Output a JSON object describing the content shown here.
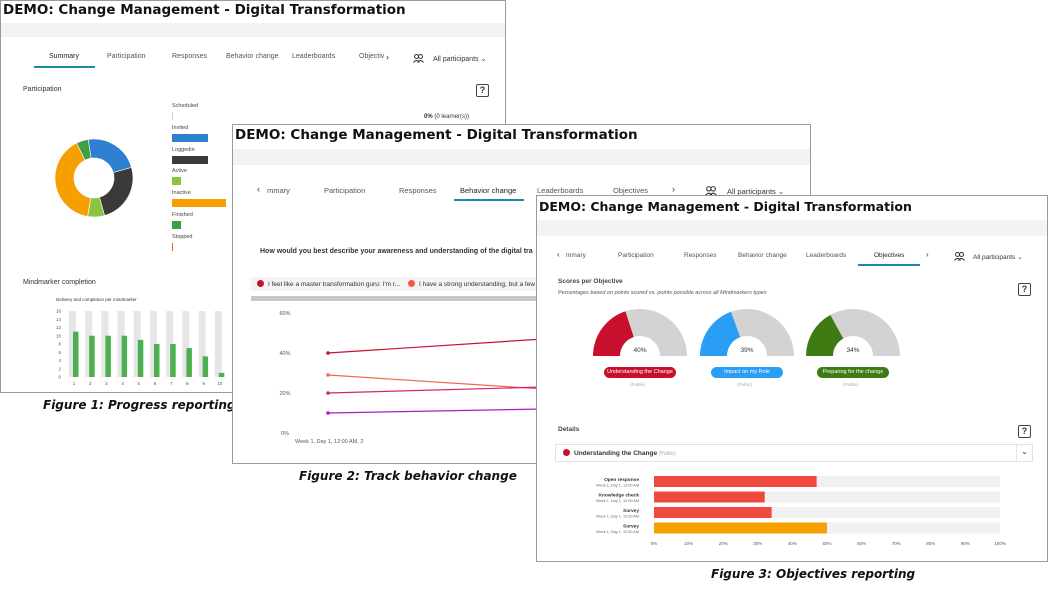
{
  "app_title": "DEMO: Change Management - Digital Transformation",
  "captions": {
    "fig1": "Figure 1: Progress reporting",
    "fig2": "Figure 2: Track behavior change",
    "fig3": "Figure 3: Objectives reporting"
  },
  "fig1": {
    "tabs": [
      "Summary",
      "Participation",
      "Responses",
      "Behavior change",
      "Leaderboards",
      "Objectiv"
    ],
    "active_tab": "Summary",
    "participants_label": "All participants",
    "participation_title": "Participation",
    "status_value": "0%",
    "status_detail": "(0 learner(s))",
    "statuses": [
      {
        "label": "Scheduled",
        "color": "#cccccc",
        "fraction": 0.0
      },
      {
        "label": "Invited",
        "color": "#2f80d1",
        "fraction": 0.6
      },
      {
        "label": "Loggedin",
        "color": "#3a3a3a",
        "fraction": 0.6
      },
      {
        "label": "Active",
        "color": "#8dc43f",
        "fraction": 0.15
      },
      {
        "label": "Inactive",
        "color": "#f5a000",
        "fraction": 0.9
      },
      {
        "label": "Finished",
        "color": "#3f9f47",
        "fraction": 0.15
      },
      {
        "label": "Stopped",
        "color": "#e0602f",
        "fraction": 0.0
      }
    ],
    "donut": [
      {
        "label": "Invited",
        "value": 23,
        "color": "#2f80d1"
      },
      {
        "label": "Loggedin",
        "value": 25,
        "color": "#3a3a3a"
      },
      {
        "label": "Active",
        "value": 7,
        "color": "#8dc43f"
      },
      {
        "label": "Inactive",
        "value": 40,
        "color": "#f5a000"
      },
      {
        "label": "Finished",
        "value": 5,
        "color": "#3f9f47"
      }
    ],
    "mindmarker_title": "Mindmarker completion",
    "chart_data": {
      "type": "bar",
      "title": "Delivery and completion per mindmarker",
      "categories": [
        "1",
        "2",
        "3",
        "4",
        "5",
        "6",
        "7",
        "8",
        "9",
        "10"
      ],
      "ylim": [
        0,
        16
      ],
      "yticks": [
        "0",
        "2",
        "4",
        "6",
        "8",
        "10",
        "12",
        "14",
        "16"
      ],
      "series": [
        {
          "values": [
            16,
            16,
            16,
            16,
            16,
            16,
            16,
            16,
            16,
            16
          ],
          "color": "#e6e6e6"
        },
        {
          "values": [
            11,
            10,
            10,
            10,
            9,
            8,
            8,
            7,
            5,
            1
          ],
          "color": "#4caf50"
        }
      ]
    }
  },
  "fig2": {
    "tabs": [
      "mmary",
      "Participation",
      "Responses",
      "Behavior change",
      "Leaderboards",
      "Objectives"
    ],
    "active_tab": "Behavior change",
    "participants_label": "All participants",
    "question": "How would you best describe your awareness and understanding of the digital tra",
    "legend": [
      {
        "label": "I feel like a master transformation guru: I'm r...",
        "color": "#c8102e"
      },
      {
        "label": "I have a strong understanding, but a few",
        "color": "#ef5b45"
      }
    ],
    "chart_data": {
      "type": "line",
      "yticks": [
        "0%",
        "20%",
        "40%",
        "60%"
      ],
      "ylim": [
        0,
        60
      ],
      "x_label_first": "Week 1, Day 1, 12:00 AM, 2",
      "series": [
        {
          "color": "#c8102e",
          "values": [
            40,
            47
          ]
        },
        {
          "color": "#ef6a4a",
          "values": [
            29,
            22
          ]
        },
        {
          "color": "#d2226e",
          "values": [
            20,
            23
          ]
        },
        {
          "color": "#a020c0",
          "values": [
            10,
            12
          ]
        }
      ]
    }
  },
  "fig3": {
    "tabs": [
      "mmary",
      "Participation",
      "Responses",
      "Behavior change",
      "Leaderboards",
      "Objectives"
    ],
    "active_tab": "Objectives",
    "participants_label": "All participants",
    "scores_title": "Scores per Objective",
    "scores_subtitle": "Percentages based on points scored vs. points possible across all Mindmarkers types",
    "gauges": [
      {
        "value": 40,
        "label": "40%",
        "name": "Understanding the Change",
        "color": "#c8102e",
        "sub": "(Public)"
      },
      {
        "value": 39,
        "label": "39%",
        "name": "Impact on my Role",
        "color": "#2a9df4",
        "sub": "(Public)"
      },
      {
        "value": 34,
        "label": "34%",
        "name": "Preparing for the change",
        "color": "#3e7b13",
        "sub": "(Public)"
      }
    ],
    "details_title": "Details",
    "details_objective": "Understanding the Change",
    "details_objective_sub": "(Public)",
    "details_color": "#c8102e",
    "chart_data": {
      "type": "bar",
      "orientation": "horizontal",
      "xticks": [
        "0%",
        "10%",
        "20%",
        "30%",
        "40%",
        "50%",
        "60%",
        "70%",
        "80%",
        "90%",
        "100%"
      ],
      "xlim": [
        0,
        100
      ],
      "bars": [
        {
          "label": "Open response",
          "sub": "Week 1, Day 1, 12:00 AM",
          "value": 47,
          "color": "#f04a3e"
        },
        {
          "label": "Knowledge check",
          "sub": "Week 1, Day 1, 12:00 AM",
          "value": 32,
          "color": "#f04a3e"
        },
        {
          "label": "Survey",
          "sub": "Week 1, Day 1, 12:00 AM",
          "value": 34,
          "color": "#f04a3e"
        },
        {
          "label": "Survey",
          "sub": "Week 1, Day 1, 12:00 AM",
          "value": 50,
          "color": "#f5a000"
        }
      ]
    }
  }
}
